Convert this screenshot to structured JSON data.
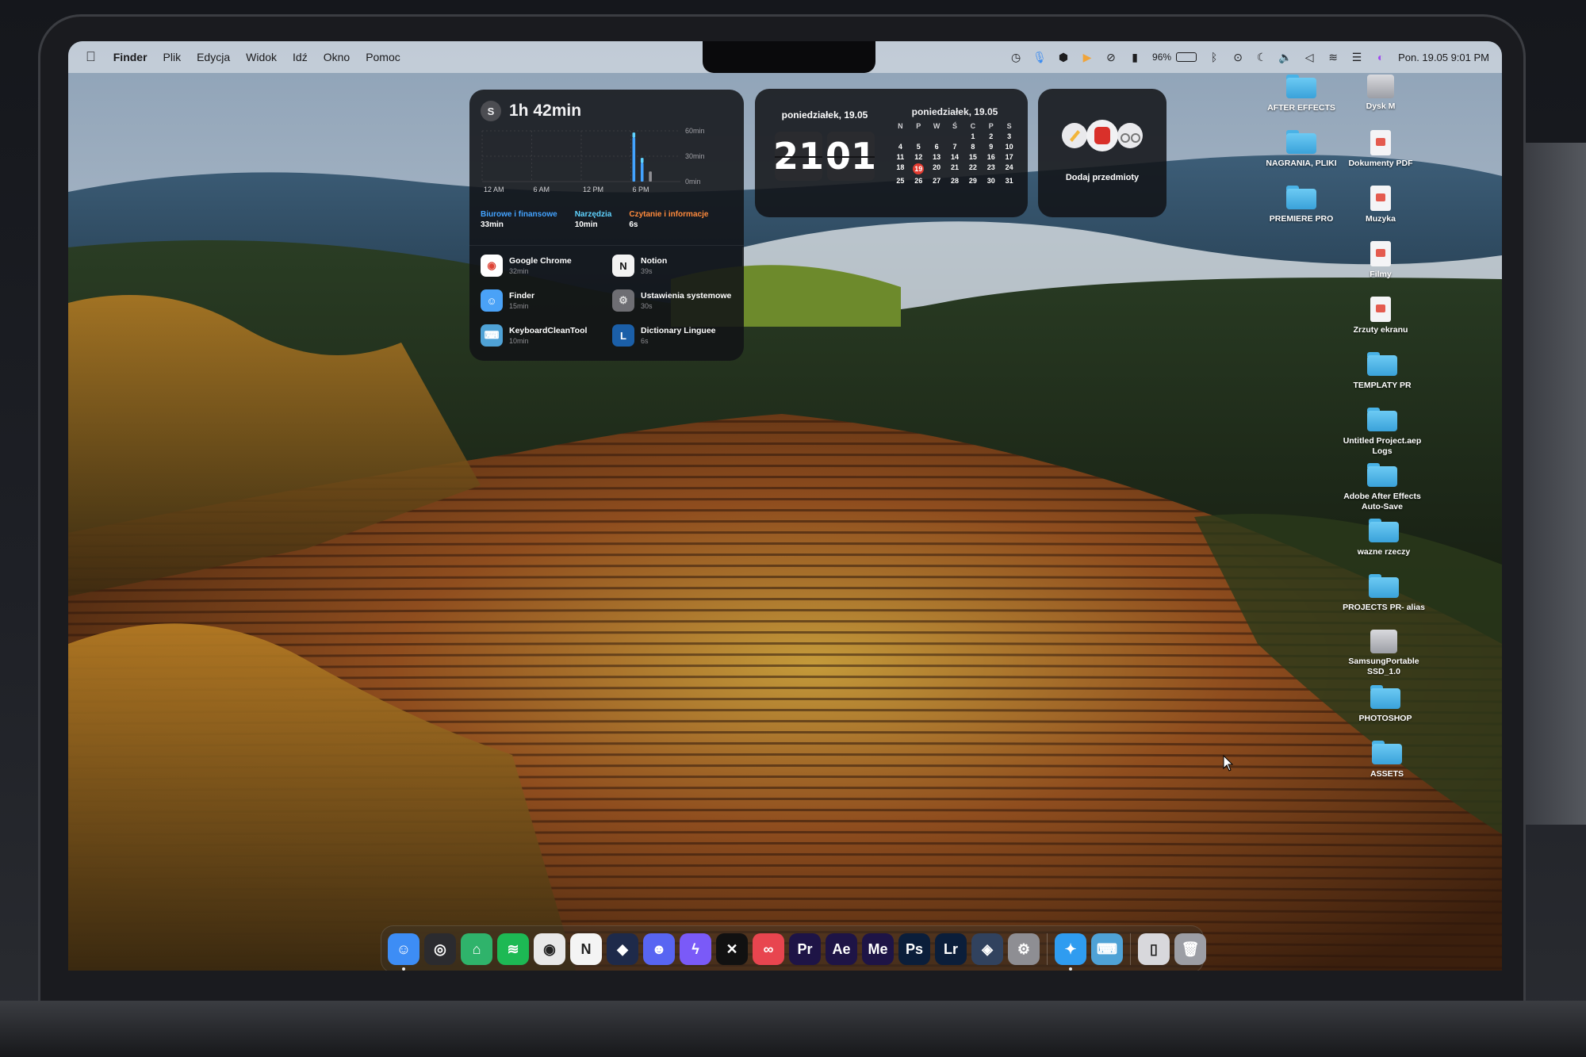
{
  "menubar": {
    "apple_icon": "apple-logo-icon",
    "app_name": "Finder",
    "items": [
      "Plik",
      "Edycja",
      "Widok",
      "Idź",
      "Okno",
      "Pomoc"
    ],
    "battery_percent": "96%",
    "datetime": "Pon. 19.05  9:01 PM",
    "status_icons": [
      "timer-icon",
      "microphone-icon",
      "shield-icon",
      "play-icon",
      "compass-icon",
      "phone-icon",
      "battery-icon",
      "bluetooth-icon",
      "record-icon",
      "moon-icon",
      "volume-icon",
      "speaker-icon",
      "wifi-icon",
      "control-center-icon",
      "siri-icon"
    ]
  },
  "screentime": {
    "avatar_letter": "S",
    "total": "1h 42min",
    "y_labels": [
      "60min",
      "30min",
      "0min"
    ],
    "x_labels": [
      "12 AM",
      "6 AM",
      "12 PM",
      "6 PM"
    ],
    "categories": [
      {
        "name": "Biurowe i finansowe",
        "value": "33min",
        "color": "#43a3ff"
      },
      {
        "name": "Narzędzia",
        "value": "10min",
        "color": "#5fd3ff"
      },
      {
        "name": "Czytanie i informacje",
        "value": "6s",
        "color": "#ff8a3c"
      }
    ],
    "apps": [
      {
        "name": "Google Chrome",
        "time": "32min",
        "icon": "chrome-icon"
      },
      {
        "name": "Notion",
        "time": "39s",
        "icon": "notion-icon"
      },
      {
        "name": "Finder",
        "time": "15min",
        "icon": "finder-icon"
      },
      {
        "name": "Ustawienia systemowe",
        "time": "30s",
        "icon": "settings-icon"
      },
      {
        "name": "KeyboardCleanTool",
        "time": "10min",
        "icon": "keyboard-icon"
      },
      {
        "name": "Dictionary Linguee",
        "time": "6s",
        "icon": "linguee-icon"
      }
    ]
  },
  "chart_data": {
    "type": "bar",
    "x_labels": [
      "12 AM",
      "6 AM",
      "12 PM",
      "6 PM"
    ],
    "y_labels": [
      "60min",
      "30min",
      "0min"
    ],
    "ylim": [
      0,
      60
    ],
    "series": [
      {
        "color": "#43a3ff",
        "values": [
          {
            "hour": 18,
            "value": 52
          },
          {
            "hour": 19,
            "value": 22
          }
        ]
      },
      {
        "color": "#5fd3ff",
        "values": [
          {
            "hour": 18,
            "value": 6
          },
          {
            "hour": 19,
            "value": 6
          }
        ]
      },
      {
        "color": "#8e8e93",
        "values": [
          {
            "hour": 20,
            "value": 12
          }
        ]
      }
    ]
  },
  "clock": {
    "date": "poniedziałek, 19.05",
    "hours": "21",
    "minutes": "01"
  },
  "calendar": {
    "title": "poniedziałek, 19.05",
    "weekdays": [
      "N",
      "P",
      "W",
      "Ś",
      "C",
      "P",
      "S"
    ],
    "weeks": [
      [
        "",
        "",
        "",
        "",
        "1",
        "2",
        "3"
      ],
      [
        "4",
        "5",
        "6",
        "7",
        "8",
        "9",
        "10"
      ],
      [
        "11",
        "12",
        "13",
        "14",
        "15",
        "16",
        "17"
      ],
      [
        "18",
        "19",
        "20",
        "21",
        "22",
        "23",
        "24"
      ],
      [
        "25",
        "26",
        "27",
        "28",
        "29",
        "30",
        "31"
      ]
    ],
    "today": "19",
    "today_color": "#e23b30"
  },
  "reminders": {
    "label": "Dodaj przedmioty"
  },
  "desktop": {
    "items": [
      {
        "label": "AFTER EFFECTS",
        "type": "folder"
      },
      {
        "label": "Dysk M",
        "type": "drive"
      },
      {
        "label": "NAGRANIA, PLIKI",
        "type": "folder"
      },
      {
        "label": "Dokumenty PDF",
        "type": "doc"
      },
      {
        "label": "PREMIERE PRO",
        "type": "folder"
      },
      {
        "label": "Muzyka",
        "type": "doc"
      },
      {
        "label": "Filmy",
        "type": "doc"
      },
      {
        "label": "Zrzuty ekranu",
        "type": "doc"
      },
      {
        "label": "TEMPLATY PR",
        "type": "folder"
      },
      {
        "label": "Untitled Project.aep Logs",
        "type": "folder"
      },
      {
        "label": "Adobe After Effects Auto-Save",
        "type": "folder"
      },
      {
        "label": "wazne rzeczy",
        "type": "folder"
      },
      {
        "label": "PROJECTS PR- alias",
        "type": "folder"
      },
      {
        "label": "SamsungPortable SSD_1.0",
        "type": "drive"
      },
      {
        "label": "PHOTOSHOP",
        "type": "folder"
      },
      {
        "label": "ASSETS",
        "type": "folder"
      }
    ],
    "folder_color": "#49b2e6"
  },
  "dock": {
    "apps": [
      {
        "icon": "finder-icon",
        "glyph": "☺",
        "bg": "#3d8df5"
      },
      {
        "icon": "obs-icon",
        "glyph": "◎",
        "bg": "#2b2b2f"
      },
      {
        "icon": "cleaner-icon",
        "glyph": "⌂",
        "bg": "#2fb36b"
      },
      {
        "icon": "spotify-icon",
        "glyph": "≋",
        "bg": "#1db954"
      },
      {
        "icon": "chrome-icon",
        "glyph": "◉",
        "bg": "#e8e8e8"
      },
      {
        "icon": "notion-icon",
        "glyph": "N",
        "bg": "#f4f4f4"
      },
      {
        "icon": "shield-app-icon",
        "glyph": "◆",
        "bg": "#1e2a4a"
      },
      {
        "icon": "discord-icon",
        "glyph": "☻",
        "bg": "#5865f2"
      },
      {
        "icon": "messenger-icon",
        "glyph": "ϟ",
        "bg": "#7a5af8"
      },
      {
        "icon": "capcut-icon",
        "glyph": "✕",
        "bg": "#111111"
      },
      {
        "icon": "creative-cloud-icon",
        "glyph": "∞",
        "bg": "#e8454f"
      },
      {
        "icon": "premiere-pro-icon",
        "glyph": "Pr",
        "bg": "#1e1446"
      },
      {
        "icon": "after-effects-icon",
        "glyph": "Ae",
        "bg": "#1e1446"
      },
      {
        "icon": "media-encoder-icon",
        "glyph": "Me",
        "bg": "#1e1446"
      },
      {
        "icon": "photoshop-icon",
        "glyph": "Ps",
        "bg": "#0b1e3a"
      },
      {
        "icon": "lightroom-icon",
        "glyph": "Lr",
        "bg": "#0b1e3a"
      },
      {
        "icon": "davinci-icon",
        "glyph": "◈",
        "bg": "#31425e"
      },
      {
        "icon": "system-settings-icon",
        "glyph": "⚙",
        "bg": "#8e8e93"
      },
      {
        "icon": "safari-icon",
        "glyph": "✦",
        "bg": "#2f9cf0"
      },
      {
        "icon": "keyboard-clean-icon",
        "glyph": "⌨",
        "bg": "#4fa2d6"
      },
      {
        "icon": "downloads-icon",
        "glyph": "▯",
        "bg": "#d8d8dc"
      },
      {
        "icon": "trash-icon",
        "glyph": "🗑",
        "bg": "#9c9ea5"
      }
    ]
  }
}
